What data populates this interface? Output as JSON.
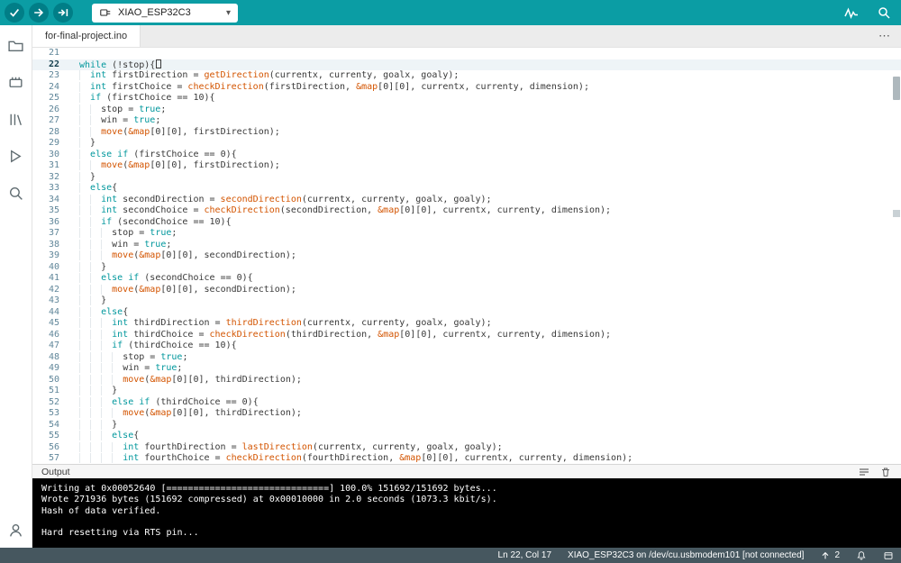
{
  "colors": {
    "toolbar_bg": "#0b9da4",
    "button_bg": "#017e87",
    "keyword": "#00979c",
    "function": "#d35400",
    "status_bg": "#46575f"
  },
  "icons": {
    "caret_down": "▾",
    "more": "⋯"
  },
  "toolbar": {
    "board_selector": "XIAO_ESP32C3"
  },
  "tabbar": {
    "tabs": [
      {
        "label": "for-final-project.ino"
      }
    ]
  },
  "editor": {
    "first_line": 21,
    "current_line": 22,
    "lines": [
      "",
      "while (!stop){",
      "  int firstDirection = getDirection(currentx, currenty, goalx, goaly);",
      "  int firstChoice = checkDirection(firstDirection, &map[0][0], currentx, currenty, dimension);",
      "  if (firstChoice == 10){",
      "    stop = true;",
      "    win = true;",
      "    move(&map[0][0], firstDirection);",
      "  }",
      "  else if (firstChoice == 0){",
      "    move(&map[0][0], firstDirection);",
      "  }",
      "  else{",
      "    int secondDirection = secondDirection(currentx, currenty, goalx, goaly);",
      "    int secondChoice = checkDirection(secondDirection, &map[0][0], currentx, currenty, dimension);",
      "    if (secondChoice == 10){",
      "      stop = true;",
      "      win = true;",
      "      move(&map[0][0], secondDirection);",
      "    }",
      "    else if (secondChoice == 0){",
      "      move(&map[0][0], secondDirection);",
      "    }",
      "    else{",
      "      int thirdDirection = thirdDirection(currentx, currenty, goalx, goaly);",
      "      int thirdChoice = checkDirection(thirdDirection, &map[0][0], currentx, currenty, dimension);",
      "      if (thirdChoice == 10){",
      "        stop = true;",
      "        win = true;",
      "        move(&map[0][0], thirdDirection);",
      "      }",
      "      else if (thirdChoice == 0){",
      "        move(&map[0][0], thirdDirection);",
      "      }",
      "      else{",
      "        int fourthDirection = lastDirection(currentx, currenty, goalx, goaly);",
      "        int fourthChoice = checkDirection(fourthDirection, &map[0][0], currentx, currenty, dimension);"
    ]
  },
  "output_panel": {
    "title": "Output"
  },
  "console": {
    "lines": [
      "Writing at 0x00052640 [==============================] 100.0% 151692/151692 bytes...",
      "Wrote 271936 bytes (151692 compressed) at 0x00010000 in 2.0 seconds (1073.3 kbit/s).",
      "Hash of data verified.",
      "",
      "Hard resetting via RTS pin..."
    ]
  },
  "statusbar": {
    "position": "Ln 22, Col 17",
    "connection": "XIAO_ESP32C3 on /dev/cu.usbmodem101 [not connected]",
    "notification_count": "2"
  }
}
